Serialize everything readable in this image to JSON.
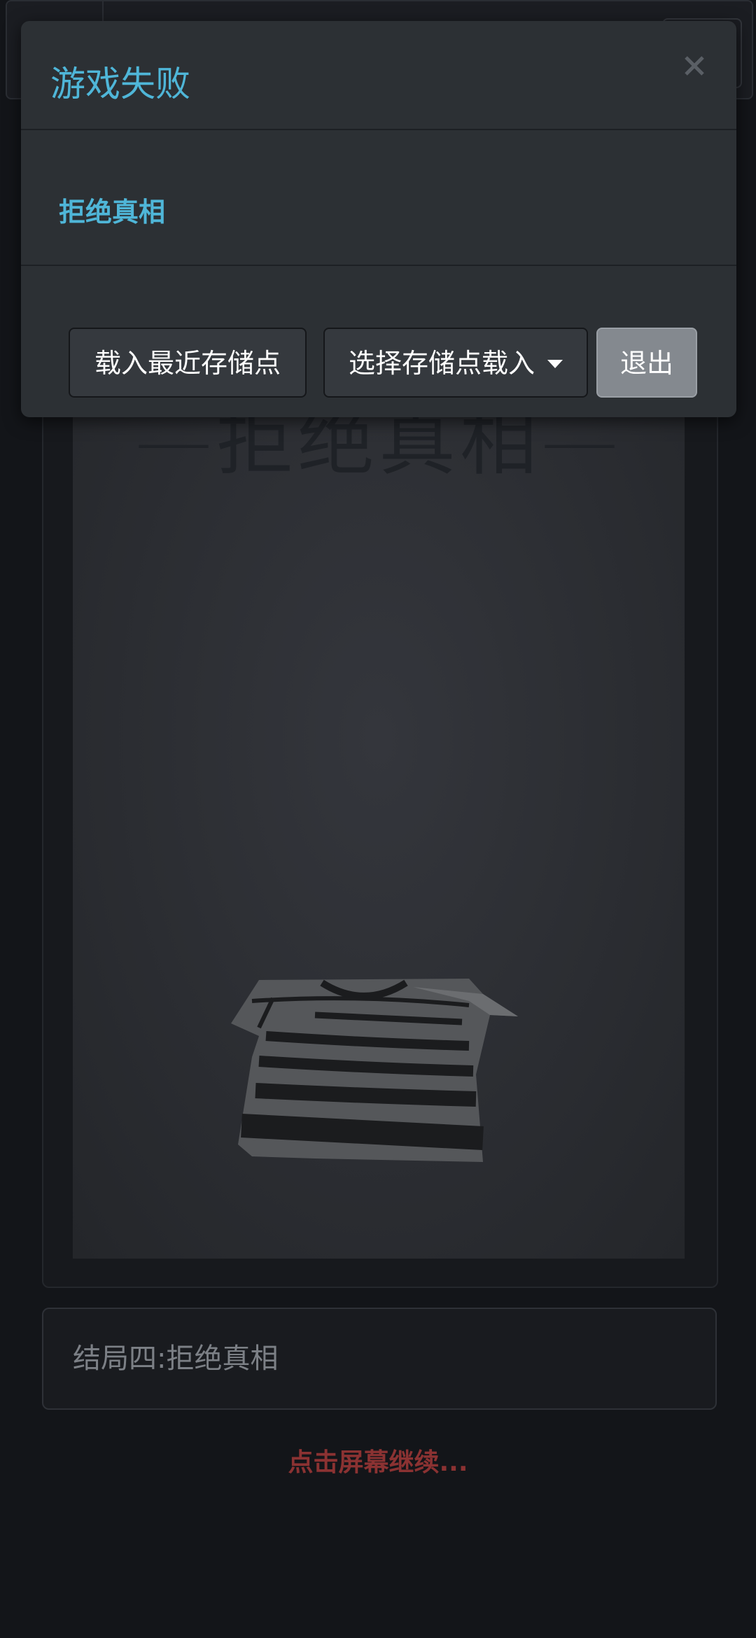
{
  "modal": {
    "title": "游戏失败",
    "close_icon": "close-icon",
    "body_text": "拒绝真相",
    "buttons": {
      "load_latest": "载入最近存储点",
      "select_save": "选择存储点载入",
      "exit": "退出"
    }
  },
  "scene": {
    "title": "—拒绝真相—",
    "image": "striped-shirt-illustration"
  },
  "caption": {
    "text": "结局四:拒绝真相"
  },
  "continue_hint": "点击屏幕继续...",
  "colors": {
    "accent": "#4fb6d8",
    "continue": "#8b3232",
    "background": "#131519",
    "modal": "#2c3034"
  }
}
